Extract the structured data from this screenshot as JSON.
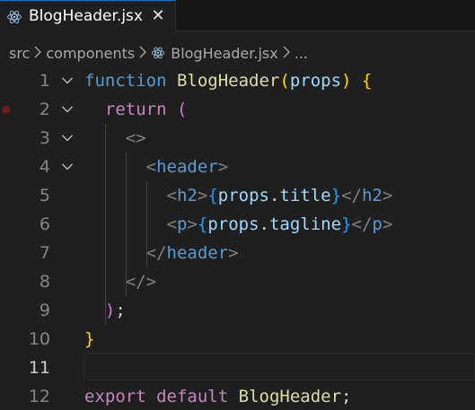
{
  "tab": {
    "label": "BlogHeader.jsx",
    "icon": "react-icon",
    "close_glyph": "✕"
  },
  "breadcrumb": {
    "items": [
      "src",
      "components",
      "BlogHeader.jsx",
      "..."
    ],
    "separator": ">"
  },
  "editor": {
    "active_line": 11,
    "lines": [
      {
        "no": "1",
        "tokens": [
          [
            "kw",
            "function"
          ],
          [
            "plain",
            " "
          ],
          [
            "fn",
            "BlogHeader"
          ],
          [
            "br1",
            "("
          ],
          [
            "param",
            "props"
          ],
          [
            "br1",
            ")"
          ],
          [
            "plain",
            " "
          ],
          [
            "br1",
            "{"
          ]
        ],
        "fold": true
      },
      {
        "no": "2",
        "tokens": [
          [
            "plain",
            "  "
          ],
          [
            "ctl",
            "return"
          ],
          [
            "plain",
            " "
          ],
          [
            "br2",
            "("
          ]
        ],
        "fold": true,
        "breakpoint": true
      },
      {
        "no": "3",
        "tokens": [
          [
            "plain",
            "    "
          ],
          [
            "punc",
            "<>"
          ]
        ],
        "fold": true
      },
      {
        "no": "4",
        "tokens": [
          [
            "plain",
            "      "
          ],
          [
            "punc",
            "<"
          ],
          [
            "tag",
            "header"
          ],
          [
            "punc",
            ">"
          ]
        ],
        "fold": true
      },
      {
        "no": "5",
        "tokens": [
          [
            "plain",
            "        "
          ],
          [
            "punc",
            "<"
          ],
          [
            "tag",
            "h2"
          ],
          [
            "punc",
            ">"
          ],
          [
            "br3",
            "{"
          ],
          [
            "prop",
            "props"
          ],
          [
            "plain",
            "."
          ],
          [
            "prop",
            "title"
          ],
          [
            "br3",
            "}"
          ],
          [
            "punc",
            "</"
          ],
          [
            "tag",
            "h2"
          ],
          [
            "punc",
            ">"
          ]
        ]
      },
      {
        "no": "6",
        "tokens": [
          [
            "plain",
            "        "
          ],
          [
            "punc",
            "<"
          ],
          [
            "tag",
            "p"
          ],
          [
            "punc",
            ">"
          ],
          [
            "br3",
            "{"
          ],
          [
            "prop",
            "props"
          ],
          [
            "plain",
            "."
          ],
          [
            "prop",
            "tagline"
          ],
          [
            "br3",
            "}"
          ],
          [
            "punc",
            "</"
          ],
          [
            "tag",
            "p"
          ],
          [
            "punc",
            ">"
          ]
        ]
      },
      {
        "no": "7",
        "tokens": [
          [
            "plain",
            "      "
          ],
          [
            "punc",
            "</"
          ],
          [
            "tag",
            "header"
          ],
          [
            "punc",
            ">"
          ]
        ]
      },
      {
        "no": "8",
        "tokens": [
          [
            "plain",
            "    "
          ],
          [
            "punc",
            "</>"
          ]
        ]
      },
      {
        "no": "9",
        "tokens": [
          [
            "plain",
            "  "
          ],
          [
            "br2",
            ")"
          ],
          [
            "plain",
            ";"
          ]
        ]
      },
      {
        "no": "10",
        "tokens": [
          [
            "br1",
            "}"
          ]
        ]
      },
      {
        "no": "11",
        "tokens": []
      },
      {
        "no": "12",
        "tokens": [
          [
            "ctl",
            "export"
          ],
          [
            "plain",
            " "
          ],
          [
            "ctl",
            "default"
          ],
          [
            "plain",
            " "
          ],
          [
            "fn",
            "BlogHeader"
          ],
          [
            "plain",
            ";"
          ]
        ]
      }
    ]
  },
  "colors": {
    "background": "#1f1f1f",
    "keyword": "#569cd6",
    "function": "#dcdcaa",
    "parameter": "#9cdcfe",
    "control": "#c586c0",
    "bracket_gold": "#ffd700",
    "bracket_orchid": "#da70d6",
    "bracket_blue": "#179fff"
  }
}
